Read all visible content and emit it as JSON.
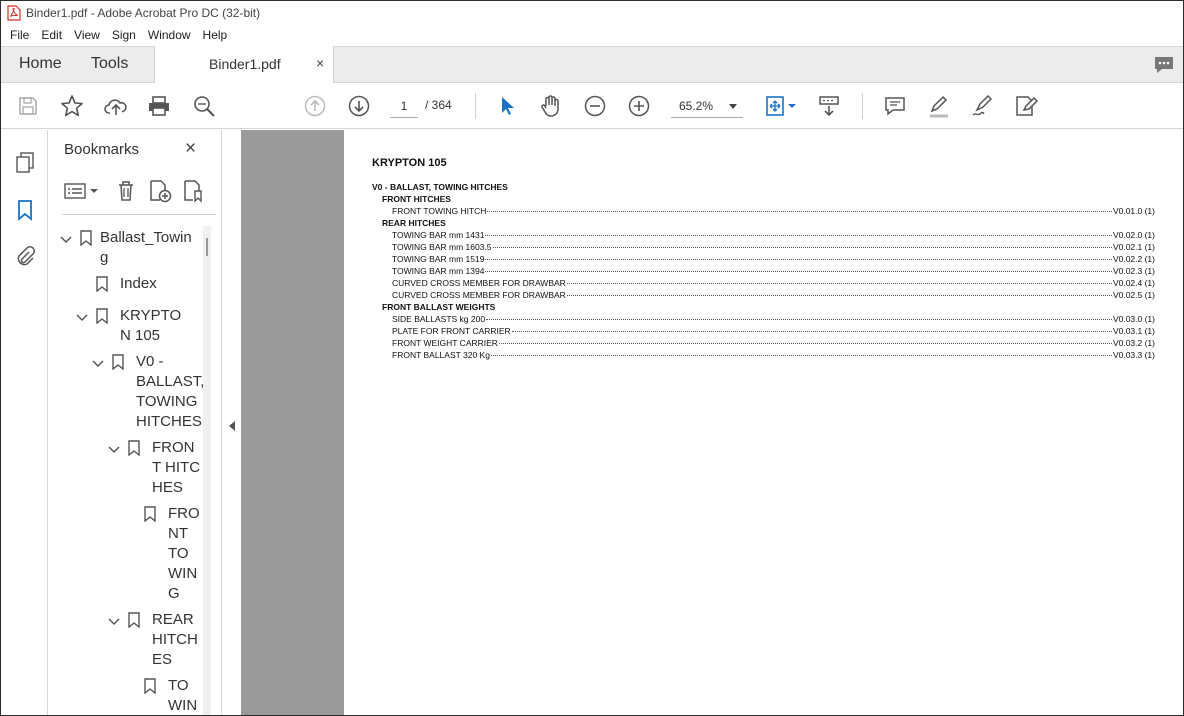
{
  "window": {
    "title": "Binder1.pdf - Adobe Acrobat Pro DC (32-bit)"
  },
  "menu": [
    "File",
    "Edit",
    "View",
    "Sign",
    "Window",
    "Help"
  ],
  "tabs": {
    "home": "Home",
    "tools": "Tools",
    "document": "Binder1.pdf",
    "close": "×"
  },
  "toolbar": {
    "current_page": "1",
    "total_pages": "/ 364",
    "zoom": "65.2%"
  },
  "bookmarks": {
    "title": "Bookmarks",
    "close": "×",
    "items": [
      {
        "label": "Ballast_Towing",
        "expanded": true
      },
      {
        "label": "Index"
      },
      {
        "label": "KRYPTON 105",
        "expanded": true
      },
      {
        "label": "V0 - BALLAST, TOWING HITCHES",
        "expanded": true
      },
      {
        "label": "FRONT HITCHES",
        "expanded": true
      },
      {
        "label": "FRONT TOWING"
      },
      {
        "label": "REAR HITCHES",
        "expanded": true
      },
      {
        "label": "TOWING"
      }
    ]
  },
  "document": {
    "title": "KRYPTON 105",
    "toc": [
      {
        "level": "h1",
        "text": "V0 - BALLAST, TOWING HITCHES"
      },
      {
        "level": "h2",
        "text": "FRONT HITCHES"
      },
      {
        "level": "item",
        "text": "FRONT TOWING HITCH",
        "ref": "V0.01.0 (1)"
      },
      {
        "level": "h2",
        "text": "REAR HITCHES"
      },
      {
        "level": "item",
        "text": "TOWING BAR mm 1431",
        "ref": "V0.02.0 (1)"
      },
      {
        "level": "item",
        "text": "TOWING BAR mm 1603.5",
        "ref": "V0.02.1 (1)"
      },
      {
        "level": "item",
        "text": "TOWING BAR mm 1519",
        "ref": "V0.02.2 (1)"
      },
      {
        "level": "item",
        "text": "TOWING BAR mm 1394",
        "ref": "V0.02.3 (1)"
      },
      {
        "level": "item",
        "text": "CURVED CROSS MEMBER FOR DRAWBAR",
        "ref": "V0.02.4 (1)"
      },
      {
        "level": "item",
        "text": "CURVED CROSS MEMBER FOR DRAWBAR",
        "ref": "V0.02.5 (1)"
      },
      {
        "level": "h2",
        "text": "FRONT BALLAST WEIGHTS"
      },
      {
        "level": "item",
        "text": "SIDE BALLASTS kg 200",
        "ref": "V0.03.0 (1)"
      },
      {
        "level": "item",
        "text": "PLATE FOR FRONT CARRIER",
        "ref": "V0.03.1 (1)"
      },
      {
        "level": "item",
        "text": "FRONT WEIGHT CARRIER",
        "ref": "V0.03.2 (1)"
      },
      {
        "level": "item",
        "text": "FRONT BALLAST 320 Kg",
        "ref": "V0.03.3 (1)"
      }
    ]
  },
  "colors": {
    "accent": "#1a73c7",
    "acrobat_red": "#d4322a",
    "doc_bg": "#9a9a9a"
  }
}
